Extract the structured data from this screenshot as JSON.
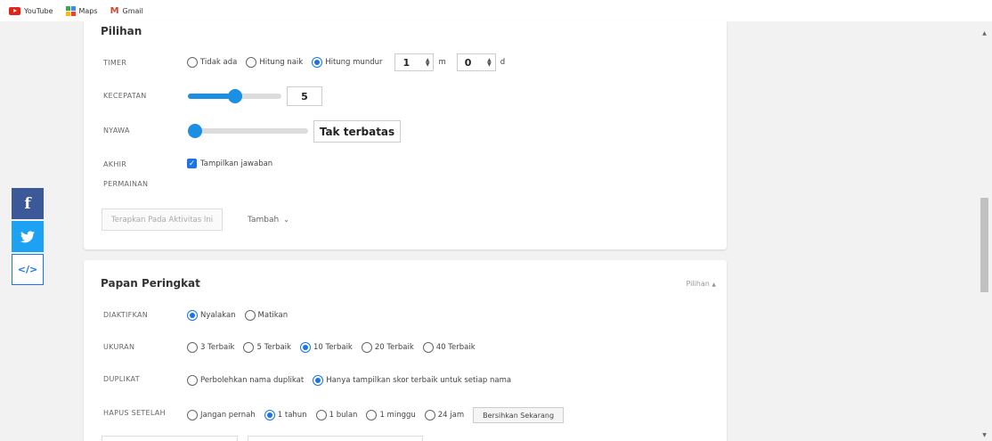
{
  "bookmarks": [
    {
      "label": "YouTube",
      "icon": "youtube-icon"
    },
    {
      "label": "Maps",
      "icon": "maps-icon"
    },
    {
      "label": "Gmail",
      "icon": "gmail-icon"
    }
  ],
  "social": {
    "facebook_glyph": "f",
    "embed_glyph": "</>"
  },
  "options": {
    "title": "Pilihan",
    "timer": {
      "label": "TIMER",
      "options": [
        "Tidak ada",
        "Hitung naik",
        "Hitung mundur"
      ],
      "selected": "Hitung mundur",
      "minutes": "1",
      "minutes_unit": "m",
      "seconds": "0",
      "seconds_unit": "d"
    },
    "speed": {
      "label": "KECEPATAN",
      "value": "5",
      "fraction": 0.5
    },
    "lives": {
      "label": "NYAWA",
      "value": "Tak terbatas",
      "fraction": 0.0
    },
    "end_game": {
      "label_line1": "AKHIR",
      "label_line2": "PERMAINAN",
      "checkbox_label": "Tampilkan jawaban",
      "checked": true
    },
    "apply_button": "Terapkan Pada Aktivitas Ini",
    "more_link": "Tambah"
  },
  "leaderboard": {
    "title": "Papan Peringkat",
    "options_link": "Pilihan",
    "enabled": {
      "label": "DIAKTIFKAN",
      "options": [
        "Nyalakan",
        "Matikan"
      ],
      "selected": "Nyalakan"
    },
    "size": {
      "label": "UKURAN",
      "options": [
        "3 Terbaik",
        "5 Terbaik",
        "10 Terbaik",
        "20 Terbaik",
        "40 Terbaik"
      ],
      "selected": "10 Terbaik"
    },
    "duplicates": {
      "label": "DUPLIKAT",
      "options": [
        "Perbolehkan nama duplikat",
        "Hanya tampilkan skor terbaik untuk setiap nama"
      ],
      "selected": "Hanya tampilkan skor terbaik untuk setiap nama"
    },
    "delete_after": {
      "label": "HAPUS SETELAH",
      "options": [
        "Jangan pernah",
        "1 tahun",
        "1 bulan",
        "1 minggu",
        "24 jam"
      ],
      "selected": "1 tahun",
      "clear_button": "Bersihkan Sekarang"
    }
  },
  "colors": {
    "accent": "#1a73e8",
    "slider": "#1a8fe3",
    "facebook": "#3b5998",
    "twitter": "#1da1f2"
  }
}
